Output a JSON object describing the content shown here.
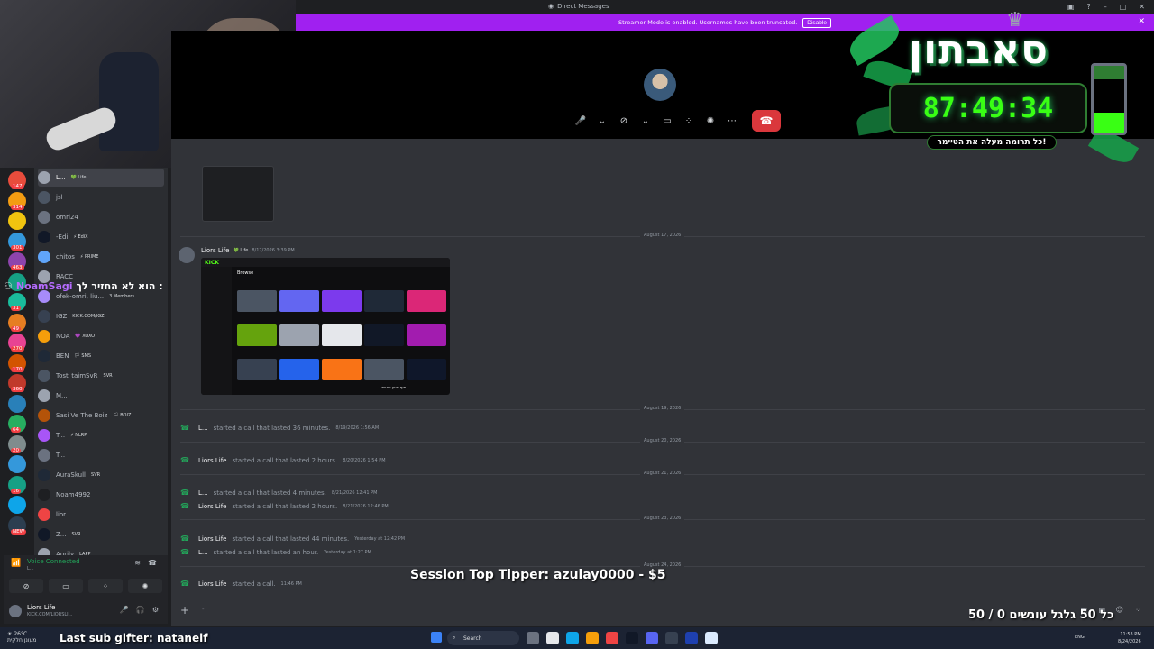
{
  "window": {
    "title": "Direct Messages"
  },
  "banner": {
    "text": "Streamer Mode is enabled. Usernames have been truncated.",
    "disable_label": "Disable"
  },
  "servers": [
    {
      "badge": "147",
      "color": "#e74c3c"
    },
    {
      "badge": "314",
      "color": "#f39c12"
    },
    {
      "badge": "",
      "color": "#f1c40f"
    },
    {
      "badge": "301",
      "color": "#3498db"
    },
    {
      "badge": "463",
      "color": "#8e44ad"
    },
    {
      "badge": "",
      "color": "#16a085"
    },
    {
      "badge": "31",
      "color": "#1abc9c"
    },
    {
      "badge": "49",
      "color": "#e67e22"
    },
    {
      "badge": "270",
      "color": "#e84393"
    },
    {
      "badge": "170",
      "color": "#d35400"
    },
    {
      "badge": "360",
      "color": "#c0392b"
    },
    {
      "badge": "",
      "color": "#2980b9"
    },
    {
      "badge": "64",
      "color": "#27ae60"
    },
    {
      "badge": "20",
      "color": "#7f8c8d"
    },
    {
      "badge": "",
      "color": "#3498db"
    },
    {
      "badge": "16",
      "color": "#16a085"
    },
    {
      "badge": "",
      "color": "#0ea5e9"
    },
    {
      "badge": "NEW",
      "color": "#2c3e50"
    }
  ],
  "dms": [
    {
      "name": "L...",
      "tag": "💚 Life",
      "active": true,
      "color": "#9ca3af"
    },
    {
      "name": "jsl",
      "tag": "",
      "active": false,
      "color": "#4b5563"
    },
    {
      "name": "omri24",
      "tag": "",
      "active": false,
      "color": "#6b7280"
    },
    {
      "name": "-Edi",
      "tag": "⚡ EdiX",
      "active": false,
      "color": "#111827"
    },
    {
      "name": "chitos",
      "tag": "⚡ PRIME",
      "active": false,
      "color": "#60a5fa"
    },
    {
      "name": "RACC",
      "tag": "",
      "active": false,
      "color": "#9ca3af"
    },
    {
      "name": "ofek-omri, liu...",
      "tag": "3 Members",
      "active": false,
      "color": "#a78bfa"
    },
    {
      "name": "IGZ",
      "tag": "KICK.COM/IGZ",
      "active": false,
      "color": "#374151"
    },
    {
      "name": "NOA",
      "tag": "💜 XOXO",
      "active": false,
      "color": "#f59e0b"
    },
    {
      "name": "BEN",
      "tag": "🏳 SMS",
      "active": false,
      "color": "#1f2937"
    },
    {
      "name": "Tost_taimSvR",
      "tag": "SVR",
      "active": false,
      "color": "#4b5563"
    },
    {
      "name": "M...",
      "tag": "",
      "active": false,
      "color": "#9ca3af"
    },
    {
      "name": "Sasi Ve The Boiz",
      "tag": "🏳 BOIZ",
      "active": false,
      "color": "#b45309"
    },
    {
      "name": "T...",
      "tag": "⚡ NLRP",
      "active": false,
      "color": "#a855f7"
    },
    {
      "name": "T...",
      "tag": "",
      "active": false,
      "color": "#6b7280"
    },
    {
      "name": "AuraSkull",
      "tag": "SVR",
      "active": false,
      "color": "#1f2937"
    },
    {
      "name": "Noam4992",
      "tag": "",
      "active": false,
      "color": "#1e1f22"
    },
    {
      "name": "lior",
      "tag": "",
      "active": false,
      "color": "#ef4444"
    },
    {
      "name": "Z...",
      "tag": "SVR",
      "active": false,
      "color": "#111827"
    },
    {
      "name": "Aprily",
      "tag": "LAPP",
      "active": false,
      "color": "#9ca3af"
    }
  ],
  "chat_overlay": {
    "user": "NoamSagi",
    "message": "הוא לא החזיר לך :"
  },
  "voice": {
    "status": "Voice Connected",
    "sub": "L..."
  },
  "user_panel": {
    "name": "Liors Life",
    "status": "KICK.COM/LIORSLI..."
  },
  "messages": {
    "date_1": "August 17, 2026",
    "author": "Liors Life",
    "author_tag": "💚 Life",
    "post_ts": "8/17/2026 3:39 PM",
    "kick_logo": "KICK",
    "kick_title": "Browse",
    "kick_caption": "סוף מגיע האוויר"
  },
  "call_log": [
    {
      "date": "August 19, 2026",
      "who": "L...",
      "text": "started a call that lasted 36 minutes.",
      "ts": "8/19/2026 1:56 AM"
    },
    {
      "date": "August 20, 2026",
      "who": "Liors Life",
      "text": "started a call that lasted 2 hours.",
      "ts": "8/20/2026 1:54 PM"
    },
    {
      "date": "August 21, 2026",
      "who": "L...",
      "text": "started a call that lasted 4 minutes.",
      "ts": "8/21/2026 12:41 PM"
    },
    {
      "date": "",
      "who": "Liors Life",
      "text": "started a call that lasted 2 hours.",
      "ts": "8/21/2026 12:46 PM"
    },
    {
      "date": "August 23, 2026",
      "who": "Liors Life",
      "text": "started a call that lasted 44 minutes.",
      "ts": "Yesterday at 12:42 PM"
    },
    {
      "date": "",
      "who": "L...",
      "text": "started a call that lasted an hour.",
      "ts": "Yesterday at 1:27 PM"
    },
    {
      "date": "August 24, 2026",
      "who": "Liors Life",
      "text": "started a call.",
      "ts": "11:46 PM"
    }
  ],
  "subathon": {
    "logo": "סאבתון",
    "timer": "87:49:34",
    "tagline": "כל תרומה מעלה את הטיימר!"
  },
  "tipper": "Session Top Tipper: azulay0000 - $5",
  "counter": "כל 50 גלגל עונשים 0 / 50",
  "taskbar": {
    "weather_temp": "26°C",
    "weather_desc": "מעונן חלקית",
    "gifter": "Last sub gifter: natanelf",
    "search": "Search",
    "lang": "ENG",
    "time": "11:53 PM",
    "date": "8/24/2026"
  },
  "colors": {
    "accent_purple": "#a020f0",
    "hangup_red": "#da373c",
    "voice_green": "#23a55a",
    "timer_green": "#39ff14"
  }
}
